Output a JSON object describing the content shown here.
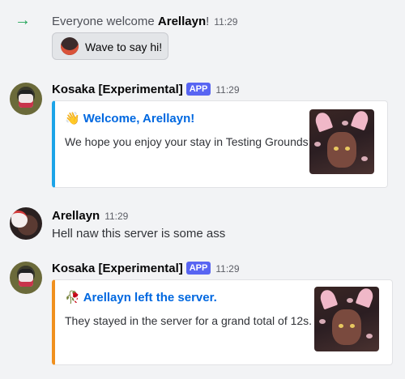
{
  "join": {
    "text_prefix": "Everyone welcome ",
    "user": "Arellayn",
    "text_suffix": "!",
    "time": "11:29",
    "wave_button": "Wave to say hi!"
  },
  "messages": [
    {
      "author": "Kosaka [Experimental]",
      "badge": "APP",
      "time": "11:29",
      "embed": {
        "color": "#1ca4e8",
        "emoji": "👋",
        "title": "Welcome, Arellayn!",
        "description": "We hope you enjoy your stay in Testing Grounds!"
      }
    },
    {
      "author": "Arellayn",
      "time": "11:29",
      "text": "Hell naw this server is some ass"
    },
    {
      "author": "Kosaka [Experimental]",
      "badge": "APP",
      "time": "11:29",
      "embed": {
        "color": "#f0901e",
        "emoji": "🥀",
        "title": "Arellayn left the server.",
        "description": "They stayed in the server for a grand total of 12s."
      }
    }
  ],
  "icons": {
    "join_arrow": "arrow-right-icon",
    "wave_sticker": "wave-sticker-icon"
  },
  "colors": {
    "join_arrow": "#23a559",
    "app_badge": "#5865f2",
    "embed_title": "#0068e0"
  }
}
